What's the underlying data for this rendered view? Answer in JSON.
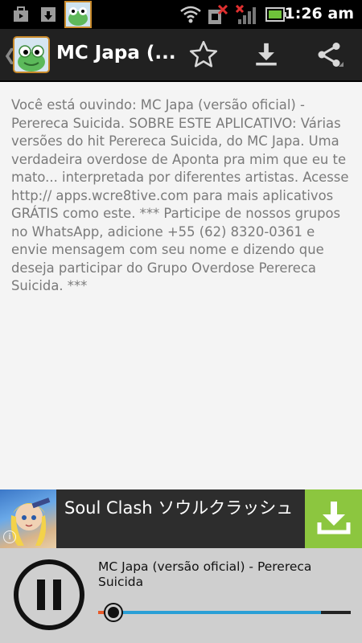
{
  "status_bar": {
    "time": "1:26 am",
    "icons": [
      "bag-icon",
      "download-notification-icon",
      "app-notification-icon",
      "wifi-icon",
      "sim-error-icon",
      "signal-icon",
      "battery-icon"
    ]
  },
  "action_bar": {
    "title": "MC Japa (...",
    "icons": [
      "back-caret-icon",
      "app-icon",
      "star-icon",
      "download-icon",
      "share-icon"
    ]
  },
  "description": "Você está ouvindo: MC Japa (versão oficial) - Perereca Suicida. SOBRE ESTE APLICATIVO: Várias versões do hit Perereca Suicida, do MC Japa. Uma verdadeira overdose de Aponta pra mim que eu te mato... interpretada por diferentes artistas. Acesse http:// apps.wcre8tive.com para mais aplicativos GRÁTIS como este. *** Participe de nossos grupos no WhatsApp, adicione +55 (62) 8320-0361 e envie mensagem com seu nome e dizendo que deseja participar do Grupo Overdose Perereca Suicida. ***",
  "ad": {
    "title": "Soul Clash ソウルクラッシュ",
    "info_label": "i",
    "accent_color": "#8cc63f"
  },
  "player": {
    "track_title": "MC Japa (versão oficial) - Perereca Suicida",
    "state": "playing",
    "progress": 0.04,
    "buffered": 0.88,
    "accent_color": "#2a9fd6"
  }
}
